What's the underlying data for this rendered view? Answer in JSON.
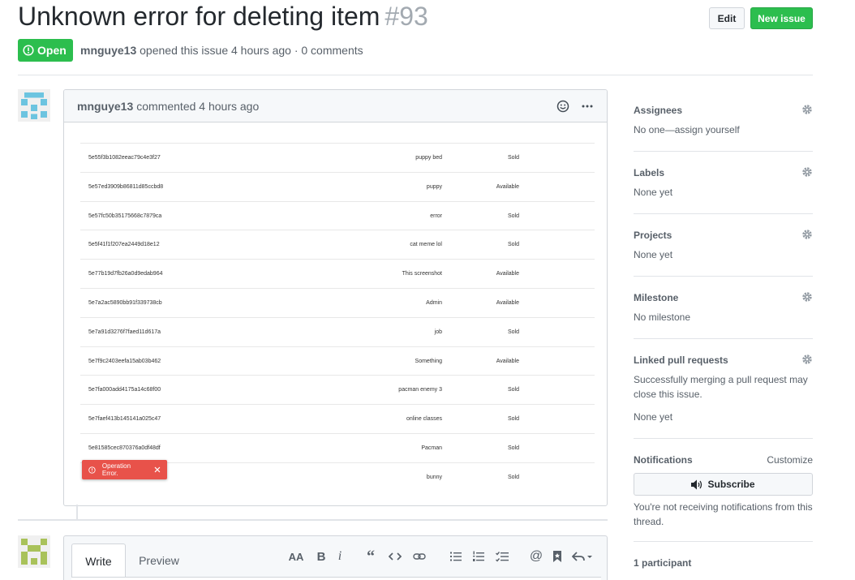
{
  "issue": {
    "title": "Unknown error for deleting item",
    "number": "#93",
    "state": "Open",
    "author": "mnguye13",
    "meta_text": "opened this issue 4 hours ago · 0 comments"
  },
  "header_buttons": {
    "edit": "Edit",
    "new_issue": "New issue"
  },
  "comment": {
    "author": "mnguye13",
    "time": "commented 4 hours ago",
    "screenshot_rows": [
      {
        "id": "5e55f3b1082eeac79c4e3f27",
        "name": "puppy bed",
        "status": "Sold"
      },
      {
        "id": "5e57ed3909b86811d85ccbd8",
        "name": "puppy",
        "status": "Available"
      },
      {
        "id": "5e57fc50b35175668c7879ca",
        "name": "error",
        "status": "Sold"
      },
      {
        "id": "5e5f41f1f207ea2449d18e12",
        "name": "cat meme lol",
        "status": "Sold"
      },
      {
        "id": "5e77b19d7fb26a0d9edab964",
        "name": "This screenshot",
        "status": "Available"
      },
      {
        "id": "5e7a2ac5890bb91f339738cb",
        "name": "Admin",
        "status": "Available"
      },
      {
        "id": "5e7a91d3276f7faed11d617a",
        "name": "job",
        "status": "Sold"
      },
      {
        "id": "5e7f9c2403eefa15ab03b462",
        "name": "Something",
        "status": "Available"
      },
      {
        "id": "5e7fa000add4175a14c68f00",
        "name": "pacman enemy 3",
        "status": "Sold"
      },
      {
        "id": "5e7faef413b145141a025c47",
        "name": "online classes",
        "status": "Sold"
      },
      {
        "id": "5e81585cec870376a0df48df",
        "name": "Pacman",
        "status": "Sold"
      },
      {
        "id": "",
        "name": "bunny",
        "status": "Sold"
      }
    ],
    "toast": "Operation Error."
  },
  "editor": {
    "tabs": [
      "Write",
      "Preview"
    ]
  },
  "sidebar": {
    "assignees": {
      "title": "Assignees",
      "value": "No one—assign yourself"
    },
    "labels": {
      "title": "Labels",
      "value": "None yet"
    },
    "projects": {
      "title": "Projects",
      "value": "None yet"
    },
    "milestone": {
      "title": "Milestone",
      "value": "No milestone"
    },
    "linked": {
      "title": "Linked pull requests",
      "desc": "Successfully merging a pull request may close this issue.",
      "value": "None yet"
    },
    "notifications": {
      "title": "Notifications",
      "customize": "Customize",
      "subscribe": "Subscribe",
      "desc": "You're not receiving notifications from this thread."
    },
    "participants": {
      "title": "1 participant"
    }
  },
  "colors": {
    "green": "#2cbe4e",
    "error_red": "#e8524a"
  }
}
